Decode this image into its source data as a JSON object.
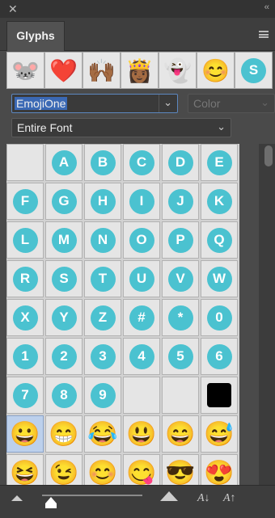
{
  "window": {
    "close_glyph": "✕",
    "collapse_glyph": "‹‹"
  },
  "panel": {
    "tab_label": "Glyphs"
  },
  "recent": [
    "🐭",
    "❤️",
    "🙌🏾",
    "👸🏾",
    "👻",
    "😊",
    "S"
  ],
  "font_family": {
    "value": "EmojiOne"
  },
  "font_style": {
    "value": "Color"
  },
  "scope": {
    "value": "Entire Font"
  },
  "glyph_rows": [
    [
      "",
      "A",
      "B",
      "C",
      "D",
      "E"
    ],
    [
      "F",
      "G",
      "H",
      "I",
      "J",
      "K"
    ],
    [
      "L",
      "M",
      "N",
      "O",
      "P",
      "Q"
    ],
    [
      "R",
      "S",
      "T",
      "U",
      "V",
      "W"
    ],
    [
      "X",
      "Y",
      "Z",
      "#",
      "*",
      "0"
    ],
    [
      "1",
      "2",
      "3",
      "4",
      "5",
      "6"
    ],
    [
      "7",
      "8",
      "9",
      "",
      "",
      "■"
    ],
    [
      "😀",
      "😁",
      "😂",
      "😃",
      "😄",
      "😅"
    ],
    [
      "😆",
      "😉",
      "😊",
      "😋",
      "😎",
      "😍"
    ]
  ],
  "selected_glyph": {
    "row": 7,
    "col": 0
  },
  "footer": {
    "smaller_label": "A↓",
    "larger_label": "A↑"
  },
  "colors": {
    "accent": "#4bc2d0",
    "selection": "#bcd0ec",
    "panel_bg": "#4a4a4a"
  }
}
